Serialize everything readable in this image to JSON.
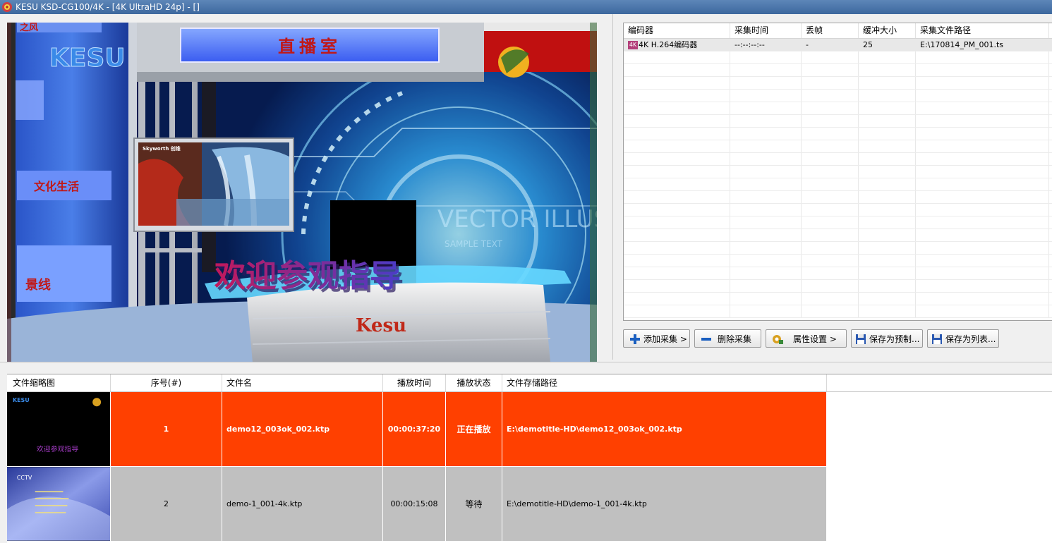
{
  "window": {
    "title": "KESU KSD-CG100/4K - [4K UltraHD 24p] - []"
  },
  "preview": {
    "studio_sign": "直播室",
    "logo_text": "KESU",
    "side_label_top": "之风",
    "side_label_mid": "文化生活",
    "side_label_bottom": "景线",
    "monitor_brand": "Skyworth 创维",
    "welcome_caption": "欢迎参观指导",
    "desk_logo": "Kesu",
    "bg_text": "VECTOR ILLUSTR",
    "bg_subtext": "SAMPLE TEXT"
  },
  "encoder_table": {
    "columns": [
      "编码器",
      "采集时间",
      "丢帧",
      "缓冲大小",
      "采集文件路径"
    ],
    "rows": [
      {
        "icon": "4K",
        "encoder": "4K H.264编码器",
        "time": "--:--:--:--",
        "dropped": "-",
        "buffer": "25",
        "path": "E:\\170814_PM_001.ts"
      }
    ]
  },
  "toolbar": {
    "add": "添加采集 >",
    "remove": "删除采集",
    "props": "属性设置 >",
    "save_preset": "保存为预制...",
    "save_list": "保存为列表..."
  },
  "playlist": {
    "columns": [
      "文件缩略图",
      "序号(#)",
      "文件名",
      "播放时间",
      "播放状态",
      "文件存储路径"
    ],
    "rows": [
      {
        "index": "1",
        "name": "demo12_003ok_002.ktp",
        "duration": "00:00:37:20",
        "status": "正在播放",
        "path": "E:\\demotitle-HD\\demo12_003ok_002.ktp",
        "thumb_logo": "KESU",
        "thumb_caption": "欢迎参观指导"
      },
      {
        "index": "2",
        "name": "demo-1_001-4k.ktp",
        "duration": "00:00:15:08",
        "status": "等待",
        "path": "E:\\demotitle-HD\\demo-1_001-4k.ktp",
        "thumb_logo": "CCTV"
      }
    ]
  },
  "colors": {
    "playing_row": "#ff4000",
    "waiting_row": "#c0c0c0",
    "titlebar": "#4a75aa"
  }
}
